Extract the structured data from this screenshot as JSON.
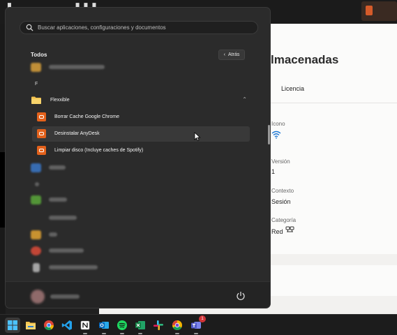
{
  "start_menu": {
    "search": {
      "placeholder": "Buscar aplicaciones, configuraciones y documentos"
    },
    "section_title": "Todos",
    "back_label": "Atrás",
    "letter_header": "F",
    "folder": {
      "label": "Flexxible",
      "items": [
        {
          "label": "Borrar Cache Google Chrome"
        },
        {
          "label": "Desinstalar AnyDesk"
        },
        {
          "label": "Limpiar disco (Incluye caches de Spotify)"
        }
      ]
    }
  },
  "background_app": {
    "heading": "lmacenadas",
    "tab_label": "Licencia",
    "fields": {
      "icono_label": "Icono",
      "version_label": "Versión",
      "version_value": "1",
      "contexto_label": "Contexto",
      "contexto_value": "Sesión",
      "categoria_label": "Categoría",
      "categoria_value": "Red"
    }
  },
  "taskbar": {
    "teams_badge": "1",
    "icons": [
      "windows-start-icon",
      "file-explorer-icon",
      "chrome-icon",
      "vscode-icon",
      "notion-icon",
      "outlook-icon",
      "spotify-icon",
      "excel-icon",
      "slack-icon",
      "chrome-alt-icon",
      "teams-icon"
    ]
  },
  "colors": {
    "menu_bg": "#2b2b2b",
    "app_icon_accent": "#e3611b",
    "page_bg": "#f2f1ef",
    "taskbar_bg": "#1c1c1c"
  }
}
